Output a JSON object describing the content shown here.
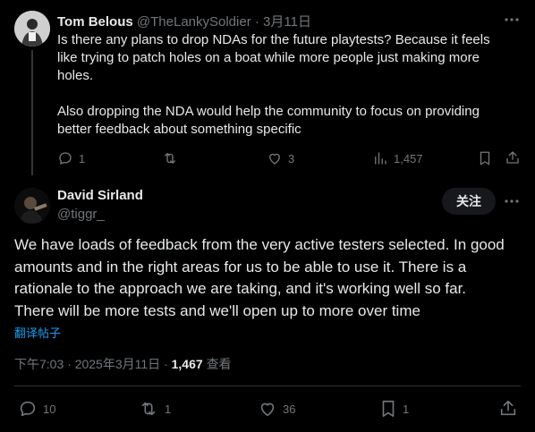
{
  "reply_to": {
    "author_name": "Tom Belous",
    "author_handle": "@TheLankySoldier",
    "separator": "·",
    "date": "3月11日",
    "text_line1": "Is there any plans to drop NDAs for the future playtests? Because it feels",
    "text_line2": "like trying to patch holes on a boat while more people just making more",
    "text_line3": "holes.",
    "text_line4": "Also dropping the NDA would help the community to focus on providing",
    "text_line5": "better feedback about something specific",
    "replies": "1",
    "retweets": "",
    "likes": "3",
    "views": "1,457"
  },
  "main": {
    "author_name": "David Sirland",
    "author_handle": "@tiggr_",
    "follow_label": "关注",
    "text_line1": "We have loads of feedback from the very active testers selected. In good",
    "text_line2": "amounts and in the right areas for us to be able to use it. There is a",
    "text_line3": "rationale to the approach we are taking, and it's working well so far.",
    "text_line4": "There will be more tests and we'll open up to more over time",
    "translate_label": "翻译帖子",
    "time": "下午7:03",
    "separator": "·",
    "date": "2025年3月11日",
    "view_count": "1,467",
    "view_label": "查看",
    "replies": "10",
    "retweets": "1",
    "likes": "36",
    "bookmarks": "1"
  },
  "colors": {
    "background": "#000000",
    "text": "#e7e9ea",
    "muted": "#71767b",
    "link": "#1d9bf0",
    "divider": "#2f3336"
  },
  "icons": [
    "more-icon",
    "reply-icon",
    "retweet-icon",
    "like-icon",
    "views-icon",
    "bookmark-icon",
    "share-icon"
  ]
}
